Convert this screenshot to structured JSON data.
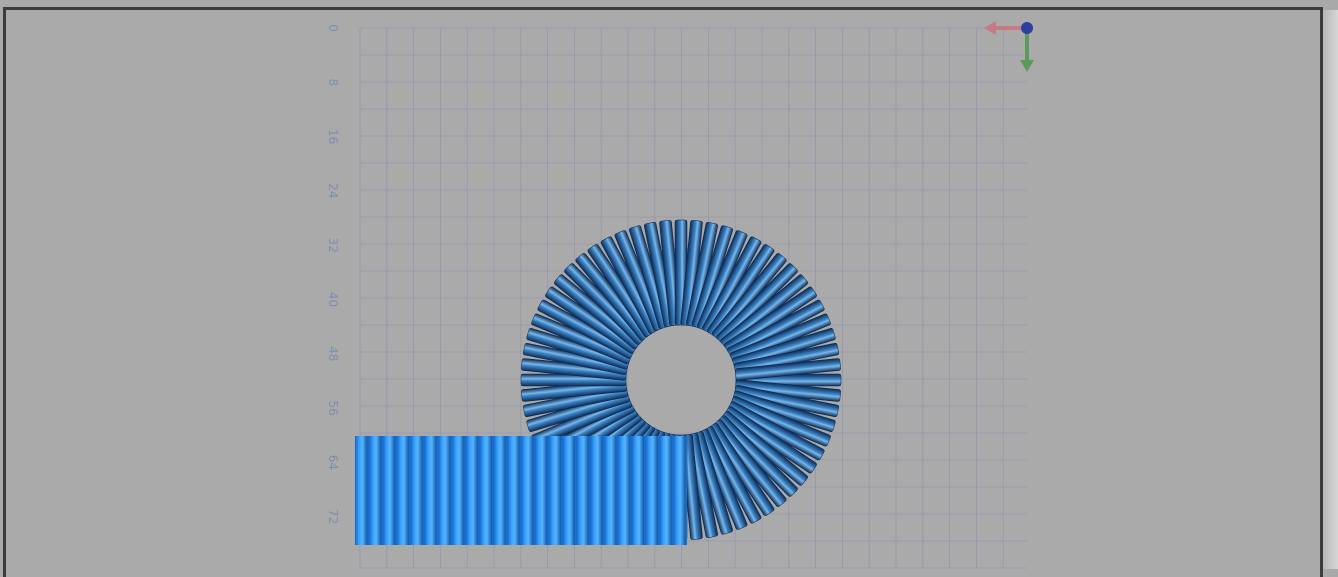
{
  "ruler": {
    "labels": [
      "0",
      "8",
      "16",
      "24",
      "32",
      "40",
      "48",
      "56",
      "64",
      "72"
    ]
  },
  "scene": {
    "background_color": "#aaaaaa",
    "grid_color": "#8a90b0",
    "ring_color": "#1c4f86",
    "block_color": "#2a8ef0"
  },
  "axis_gizmo": {
    "x_axis_color": "#c57a86",
    "y_axis_color": "#5a9a5a",
    "origin_color": "#2c3e9e"
  }
}
